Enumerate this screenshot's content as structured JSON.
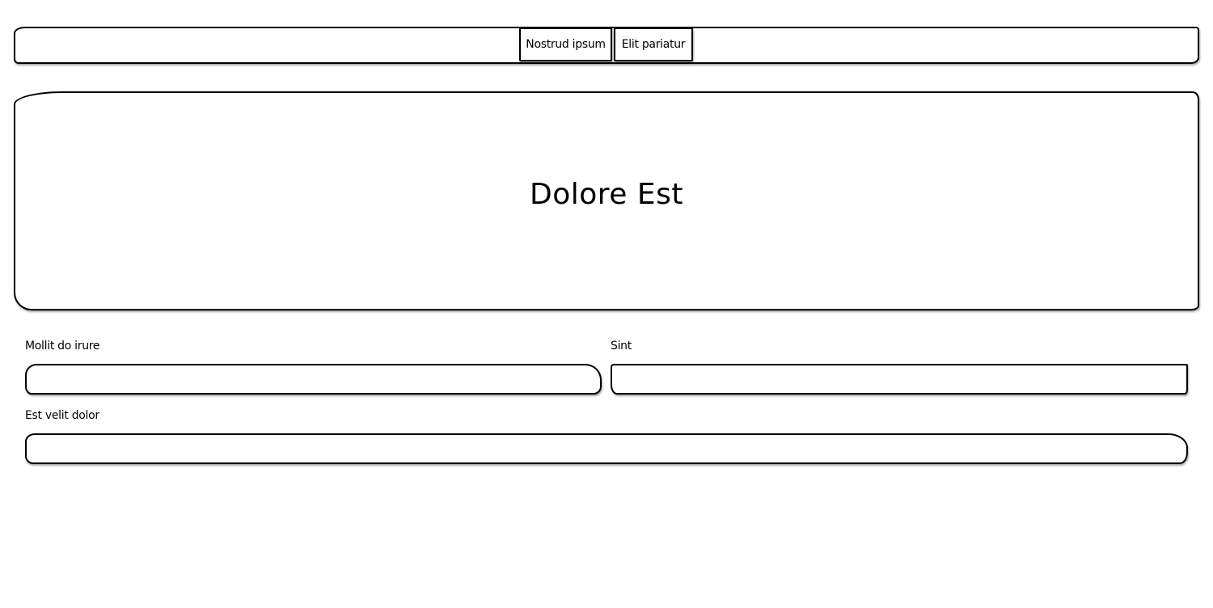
{
  "nav": {
    "buttons": [
      {
        "label": "Nostrud ipsum"
      },
      {
        "label": "Elit pariatur"
      }
    ]
  },
  "hero": {
    "title": "Dolore Est"
  },
  "form": {
    "fields": [
      {
        "label": "Mollit do irure",
        "value": "",
        "placeholder": ""
      },
      {
        "label": "Sint",
        "value": "",
        "placeholder": ""
      },
      {
        "label": "Est velit dolor",
        "value": "",
        "placeholder": ""
      }
    ]
  }
}
